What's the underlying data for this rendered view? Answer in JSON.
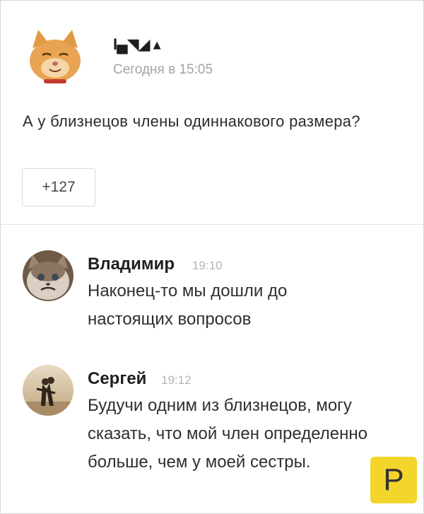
{
  "post": {
    "author_name": "I▄◥◢ ▴",
    "timestamp": "Сегодня в 15:05",
    "text": "А у близнецов члены одиннакового размера?",
    "likes": "+127",
    "avatar": "cat-avatar"
  },
  "comments": [
    {
      "name": "Владимир",
      "time": "19:10",
      "text": "Наконец-то мы дошли до настоящих вопросов",
      "avatar": "grumpy-cat-avatar"
    },
    {
      "name": "Сергей",
      "time": "19:12",
      "text": "Будучи одним из близнецов, могу сказать, что мой член определенно больше, чем у моей сестры.",
      "avatar": "couple-photo-avatar"
    }
  ],
  "watermark": {
    "letter": "P",
    "color": "#f2d21a"
  }
}
